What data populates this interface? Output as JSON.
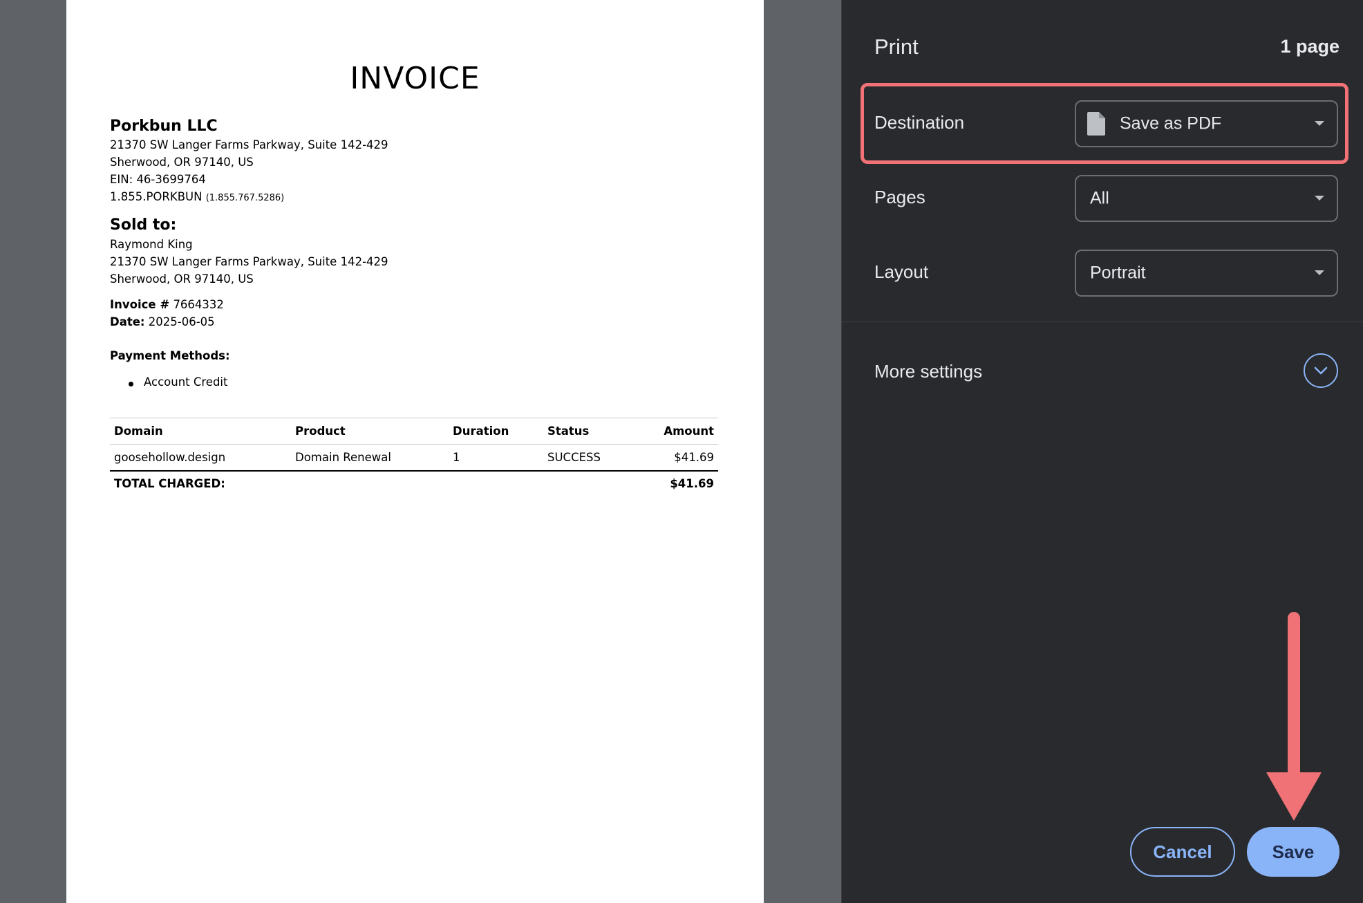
{
  "invoice": {
    "title": "INVOICE",
    "company": {
      "name": "Porkbun LLC",
      "address1": "21370 SW Langer Farms Parkway, Suite 142-429",
      "address2": "Sherwood, OR 97140, US",
      "ein": "EIN: 46-3699764",
      "phone": "1.855.PORKBUN",
      "phone_numeric": "(1.855.767.5286)"
    },
    "sold_to": {
      "heading": "Sold to:",
      "name": "Raymond King",
      "address1": "21370 SW Langer Farms Parkway, Suite 142-429",
      "address2": "Sherwood, OR 97140, US"
    },
    "invoice_number_label": "Invoice #",
    "invoice_number": "7664332",
    "date_label": "Date:",
    "date": "2025-06-05",
    "payment_methods_label": "Payment Methods:",
    "payment_methods": [
      "Account Credit"
    ],
    "table": {
      "headers": [
        "Domain",
        "Product",
        "Duration",
        "Status",
        "Amount"
      ],
      "rows": [
        [
          "goosehollow.design",
          "Domain Renewal",
          "1",
          "SUCCESS",
          "$41.69"
        ]
      ],
      "total_label": "TOTAL CHARGED:",
      "total_value": "$41.69"
    }
  },
  "print_panel": {
    "title": "Print",
    "page_count": "1 page",
    "destination": {
      "label": "Destination",
      "value": "Save as PDF",
      "icon": "file-icon"
    },
    "pages": {
      "label": "Pages",
      "value": "All"
    },
    "layout": {
      "label": "Layout",
      "value": "Portrait"
    },
    "more_settings": {
      "label": "More settings",
      "icon": "chevron-down-icon"
    },
    "cancel_label": "Cancel",
    "save_label": "Save"
  },
  "colors": {
    "panel_bg": "#292a2d",
    "preview_bg": "#5f6368",
    "accent": "#8ab4f8",
    "annotation": "#f07276"
  }
}
